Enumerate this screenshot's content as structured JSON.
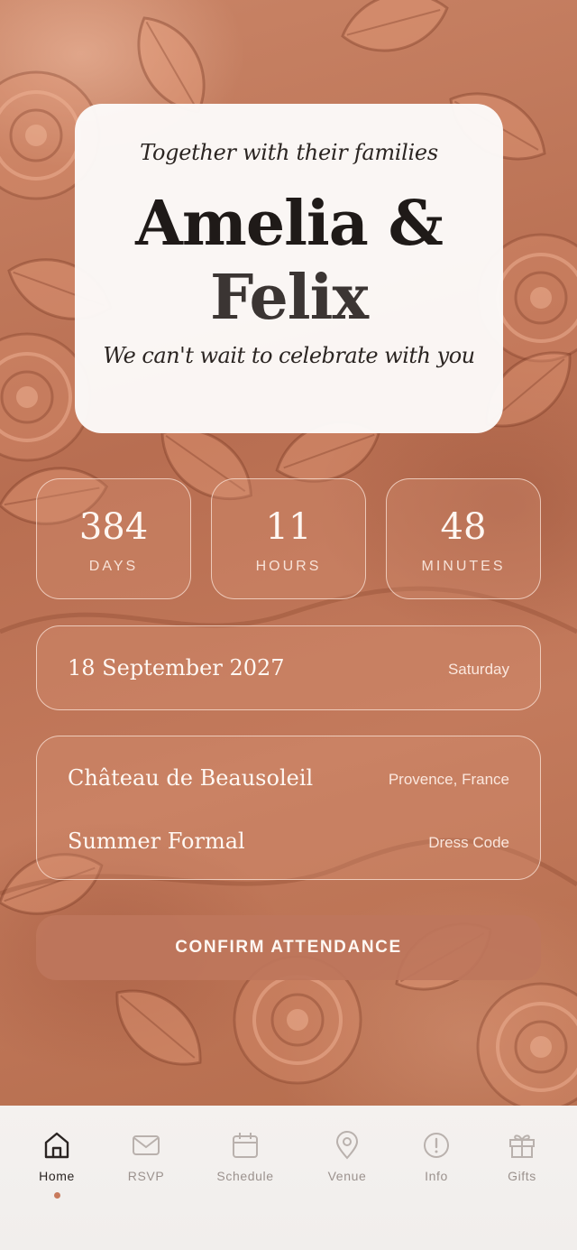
{
  "hero": {
    "tagline": "Together with their families",
    "name_line1": "Amelia &",
    "name_line2": "Felix",
    "subline": "We can't wait to celebrate with you"
  },
  "countdown": [
    {
      "value": "384",
      "unit": "DAYS"
    },
    {
      "value": "11",
      "unit": "HOURS"
    },
    {
      "value": "48",
      "unit": "MINUTES"
    }
  ],
  "date_card": {
    "date": "18 September 2027",
    "weekday": "Saturday"
  },
  "venue_card": {
    "venue": "Château de Beausoleil",
    "location": "Provence, France",
    "dress_code": "Summer Formal",
    "dress_code_label": "Dress Code"
  },
  "cta": {
    "label": "CONFIRM ATTENDANCE"
  },
  "tabs": [
    {
      "label": "Home",
      "icon": "home-icon",
      "active": true
    },
    {
      "label": "RSVP",
      "icon": "envelope-icon",
      "active": false
    },
    {
      "label": "Schedule",
      "icon": "calendar-icon",
      "active": false
    },
    {
      "label": "Venue",
      "icon": "map-pin-icon",
      "active": false
    },
    {
      "label": "Info",
      "icon": "info-icon",
      "active": false
    },
    {
      "label": "Gifts",
      "icon": "gift-icon",
      "active": false
    }
  ],
  "colors": {
    "background": "#c07a5c",
    "accent": "#c87a5c",
    "button": "#be765c",
    "tabbar": "#f4f1ef"
  }
}
